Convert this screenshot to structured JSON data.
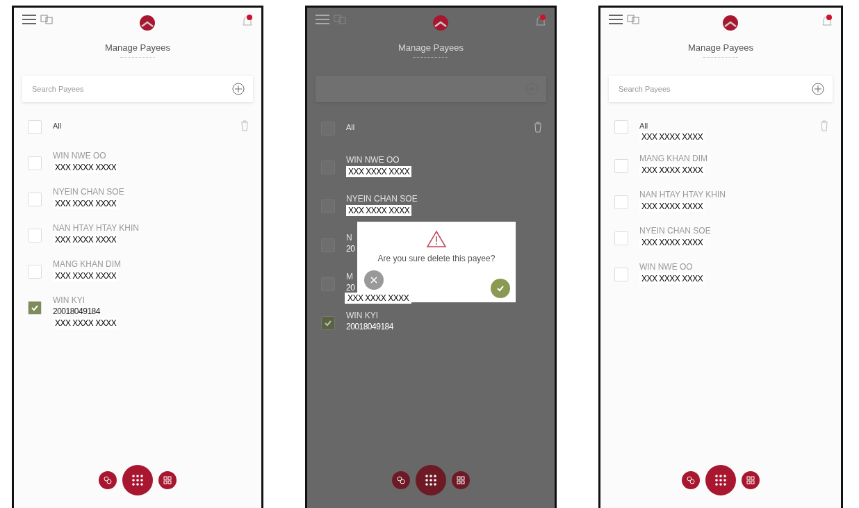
{
  "screens": [
    {
      "title": "Manage Payees",
      "search": {
        "placeholder": "Search Payees"
      },
      "dimmed": false,
      "all": {
        "label": "All",
        "checked": false
      },
      "payees": [
        {
          "name": "WIN NWE OO",
          "checked": false,
          "lines": [
            {
              "text": "XXX XXXX XXXX",
              "kind": "mask"
            }
          ]
        },
        {
          "name": "NYEIN CHAN SOE",
          "checked": false,
          "lines": [
            {
              "text": "XXX XXXX XXXX",
              "kind": "mask"
            }
          ]
        },
        {
          "name": "NAN HTAY HTAY KHIN",
          "checked": false,
          "lines": [
            {
              "text": "XXX XXXX XXXX",
              "kind": "mask"
            }
          ]
        },
        {
          "name": "MANG KHAN DIM",
          "checked": false,
          "lines": [
            {
              "text": "XXX XXXX XXXX",
              "kind": "mask"
            }
          ]
        },
        {
          "name": "WIN KYI",
          "checked": true,
          "lines": [
            {
              "text": "20018049184",
              "kind": "plain"
            },
            {
              "text": "XXX XXXX XXXX",
              "kind": "mask"
            }
          ]
        }
      ]
    },
    {
      "title": "Manage Payees",
      "dimmed": true,
      "all": {
        "label": "All",
        "checked": false
      },
      "payees": [
        {
          "name": "WIN NWE OO",
          "checked": false,
          "lines": [
            {
              "text": "XXX XXXX XXXX",
              "kind": "mask"
            }
          ]
        },
        {
          "name": "NYEIN CHAN SOE",
          "checked": false,
          "lines": [
            {
              "text": "XXX XXXX XXXX",
              "kind": "mask"
            }
          ]
        },
        {
          "name": "N",
          "checked": false,
          "lines": [
            {
              "text": "20",
              "kind": "plain"
            }
          ]
        },
        {
          "name": "M",
          "checked": false,
          "lines": [
            {
              "text": "20",
              "kind": "plain"
            }
          ]
        },
        {
          "name": "WIN KYI",
          "checked": true,
          "lines": [
            {
              "text": "20018049184",
              "kind": "plain"
            }
          ]
        }
      ],
      "dialog": {
        "message": "Are you sure delete this payee?",
        "mask": "XXX XXXX XXXX"
      }
    },
    {
      "title": "Manage Payees",
      "search": {
        "placeholder": "Search Payees"
      },
      "dimmed": false,
      "all": {
        "label": "All",
        "checked": false,
        "lines": [
          {
            "text": "XXX XXXX XXXX",
            "kind": "mask"
          }
        ]
      },
      "payees": [
        {
          "name": "MANG KHAN DIM",
          "checked": false,
          "lines": [
            {
              "text": "XXX XXXX XXXX",
              "kind": "mask"
            }
          ]
        },
        {
          "name": "NAN HTAY HTAY KHIN",
          "checked": false,
          "lines": [
            {
              "text": "XXX XXXX XXXX",
              "kind": "mask"
            }
          ]
        },
        {
          "name": "NYEIN CHAN SOE",
          "checked": false,
          "lines": [
            {
              "text": "XXX XXXX XXXX",
              "kind": "mask"
            }
          ]
        },
        {
          "name": "WIN NWE OO",
          "checked": false,
          "lines": [
            {
              "text": "XXX XXXX XXXX",
              "kind": "mask"
            }
          ]
        }
      ]
    }
  ]
}
